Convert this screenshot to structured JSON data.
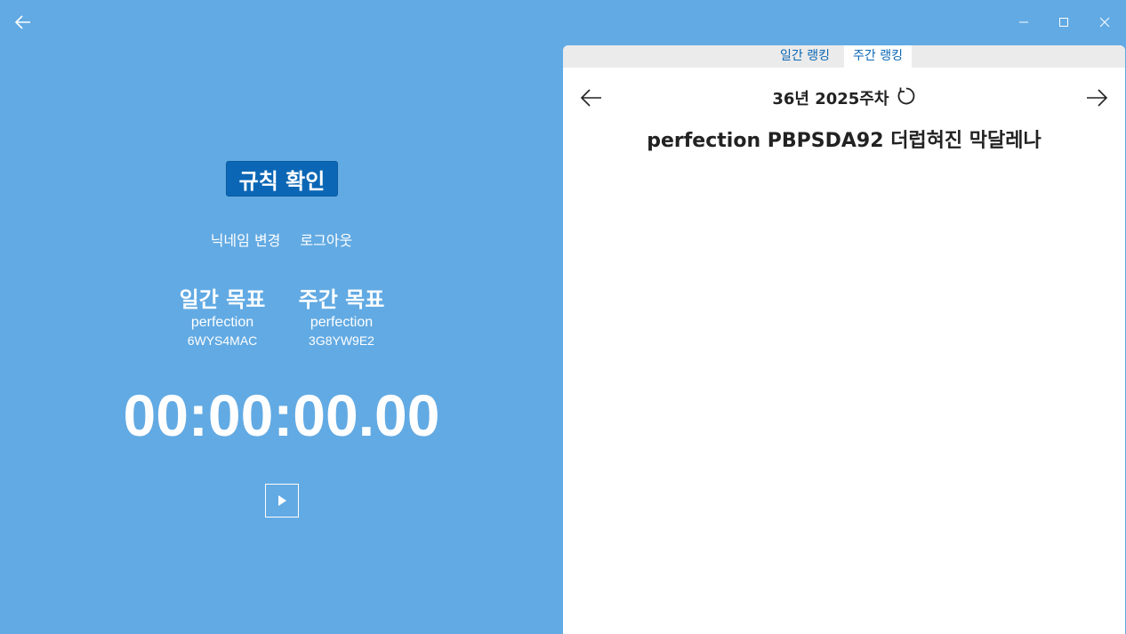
{
  "titlebar": {
    "back_icon": "arrow-left-icon",
    "minimize_icon": "minimize-icon",
    "maximize_icon": "maximize-icon",
    "close_icon": "close-icon"
  },
  "left": {
    "rules_button": "규칙 확인",
    "change_nickname": "닉네임 변경",
    "logout": "로그아웃",
    "daily_goal": {
      "title": "일간 목표",
      "name": "perfection",
      "code": "6WYS4MAC"
    },
    "weekly_goal": {
      "title": "주간 목표",
      "name": "perfection",
      "code": "3G8YW9E2"
    },
    "timer": "00:00:00.00",
    "play_icon": "play-icon"
  },
  "right": {
    "tabs": [
      {
        "label": "일간 랭킹",
        "selected": false
      },
      {
        "label": "주간 랭킹",
        "selected": true
      }
    ],
    "week_label": "36년 2025주차",
    "refresh_icon": "refresh-icon",
    "prev_icon": "arrow-left-icon",
    "next_icon": "arrow-right-icon",
    "entries": [
      {
        "text": "perfection PBPSDA92 더럽혀진 막달레나"
      }
    ]
  },
  "colors": {
    "background": "#62aae3",
    "accent": "#0b67b5",
    "panel": "#ffffff"
  }
}
